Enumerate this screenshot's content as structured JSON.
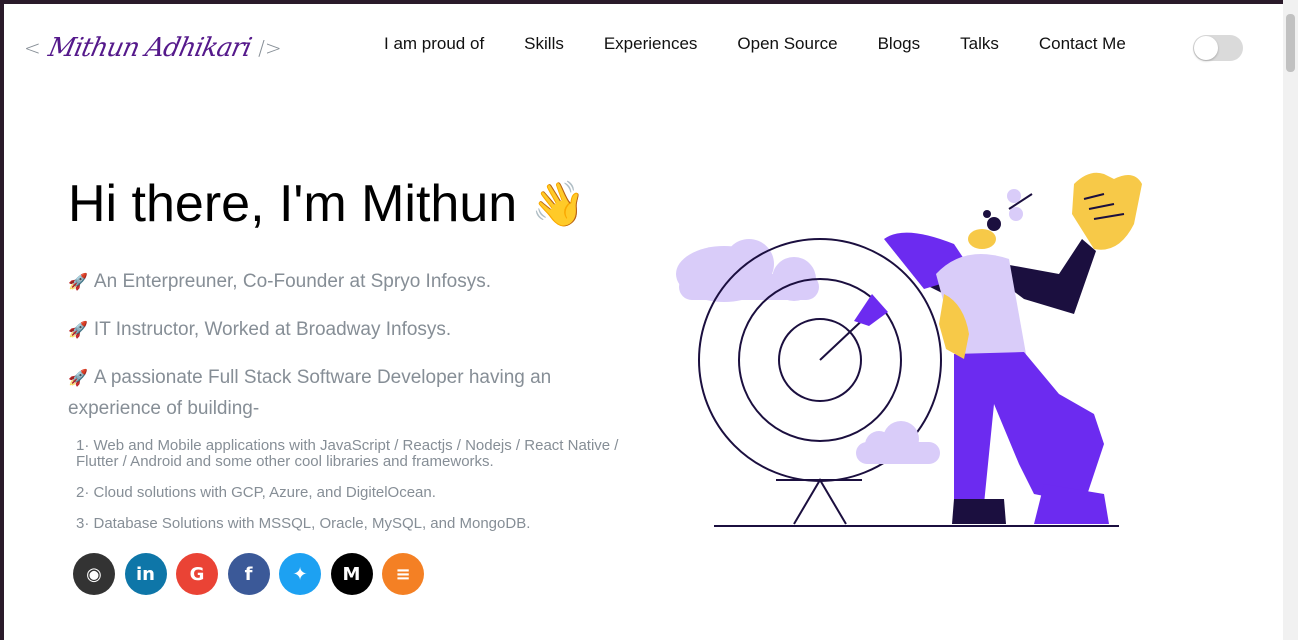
{
  "logo": {
    "open": "<",
    "name": "Mithun Adhikari",
    "close": "/>"
  },
  "nav": [
    "I am proud of",
    "Skills",
    "Experiences",
    "Open Source",
    "Blogs",
    "Talks",
    "Contact Me"
  ],
  "greeting": {
    "text": "Hi there, I'm Mithun",
    "emoji": "👋"
  },
  "bullets": [
    {
      "icon": "🚀",
      "text": "An Enterpreuner, Co-Founder at Spryo Infosys."
    },
    {
      "icon": "🚀",
      "text": "IT Instructor, Worked at Broadway Infosys."
    },
    {
      "icon": "🚀",
      "text": "A passionate Full Stack Software Developer having an experience of building-"
    }
  ],
  "subpoints": [
    "1· Web and Mobile applications with JavaScript / Reactjs / Nodejs / React Native / Flutter / Android and some other cool libraries and frameworks.",
    "2· Cloud solutions with GCP, Azure, and DigitelOcean.",
    "3· Database Solutions with MSSQL, Oracle, MySQL, and MongoDB."
  ],
  "socials": [
    {
      "name": "github",
      "glyph": "◉",
      "color": "#333333"
    },
    {
      "name": "linkedin",
      "glyph": "in",
      "color": "#0e76a8"
    },
    {
      "name": "google",
      "glyph": "G",
      "color": "#ea4335"
    },
    {
      "name": "facebook",
      "glyph": "f",
      "color": "#3b5998"
    },
    {
      "name": "twitter",
      "glyph": "✦",
      "color": "#1da1f2"
    },
    {
      "name": "medium",
      "glyph": "M",
      "color": "#000000"
    },
    {
      "name": "stack-overflow",
      "glyph": "≡",
      "color": "#f48024"
    }
  ],
  "colors": {
    "accent": "#55198b",
    "purple": "#6c2bf0",
    "lavender": "#d9ccf9",
    "muted": "#868e96"
  }
}
